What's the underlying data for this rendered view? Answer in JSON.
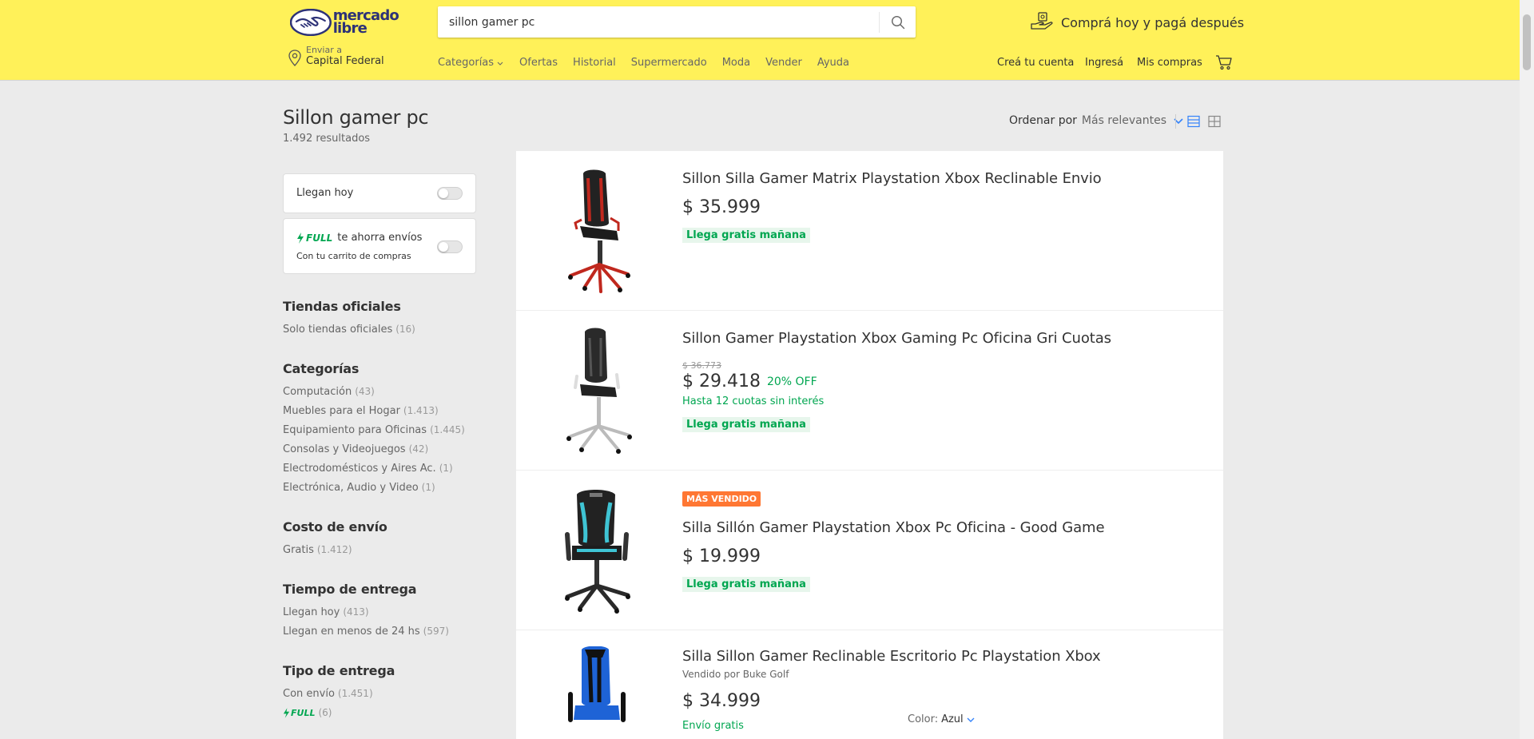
{
  "header": {
    "logo_line1": "mercado",
    "logo_line2": "libre",
    "search_value": "sillon gamer pc",
    "promo": "Comprá hoy y pagá después",
    "address_label": "Enviar a",
    "address_value": "Capital Federal",
    "nav": [
      "Categorías",
      "Ofertas",
      "Historial",
      "Supermercado",
      "Moda",
      "Vender",
      "Ayuda"
    ],
    "account": {
      "create": "Creá tu cuenta",
      "login": "Ingresá",
      "purchases": "Mis compras"
    }
  },
  "main": {
    "title": "Sillon gamer pc",
    "results": "1.492 resultados",
    "sort_label": "Ordenar por",
    "sort_value": "Más relevantes"
  },
  "filters": {
    "llegan_hoy": "Llegan hoy",
    "full_badge": "FULL",
    "full_text": "te ahorra envíos",
    "full_sub": "Con tu carrito de compras",
    "sections": [
      {
        "title": "Tiendas oficiales",
        "items": [
          {
            "label": "Solo tiendas oficiales",
            "count": "(16)"
          }
        ]
      },
      {
        "title": "Categorías",
        "items": [
          {
            "label": "Computación",
            "count": "(43)"
          },
          {
            "label": "Muebles para el Hogar",
            "count": "(1.413)"
          },
          {
            "label": "Equipamiento para Oficinas",
            "count": "(1.445)"
          },
          {
            "label": "Consolas y Videojuegos",
            "count": "(42)"
          },
          {
            "label": "Electrodomésticos y Aires Ac.",
            "count": "(1)"
          },
          {
            "label": "Electrónica, Audio y Video",
            "count": "(1)"
          }
        ]
      },
      {
        "title": "Costo de envío",
        "items": [
          {
            "label": "Gratis",
            "count": "(1.412)"
          }
        ]
      },
      {
        "title": "Tiempo de entrega",
        "items": [
          {
            "label": "Llegan hoy",
            "count": "(413)"
          },
          {
            "label": "Llegan en menos de 24 hs",
            "count": "(597)"
          }
        ]
      },
      {
        "title": "Tipo de entrega",
        "items": [
          {
            "label": "Con envío",
            "count": "(1.451)"
          },
          {
            "label": "FULL",
            "count": "(6)"
          }
        ]
      }
    ]
  },
  "products": [
    {
      "title": "Sillon Silla Gamer Matrix Playstation Xbox Reclinable Envio",
      "price": "$ 35.999",
      "shipping": "Llega gratis mañana",
      "accent": "#c0281e"
    },
    {
      "title": "Sillon Gamer Playstation Xbox Gaming Pc Oficina Gri Cuotas",
      "old_price": "$ 36.773",
      "price": "$ 29.418",
      "discount": "20% OFF",
      "installments": "Hasta 12 cuotas sin interés",
      "shipping": "Llega gratis mañana",
      "accent": "#555555"
    },
    {
      "badge": "MÁS VENDIDO",
      "title": "Silla Sillón Gamer Playstation Xbox Pc Oficina - Good Game",
      "price": "$ 19.999",
      "shipping": "Llega gratis mañana",
      "accent": "#3fc4d4"
    },
    {
      "title": "Silla Sillon Gamer Reclinable Escritorio Pc Playstation Xbox",
      "seller": "Vendido por Buke Golf",
      "price": "$ 34.999",
      "shipping": "Envío gratis",
      "color_label": "Color:",
      "color_value": "Azul",
      "accent": "#1e63d6"
    }
  ]
}
